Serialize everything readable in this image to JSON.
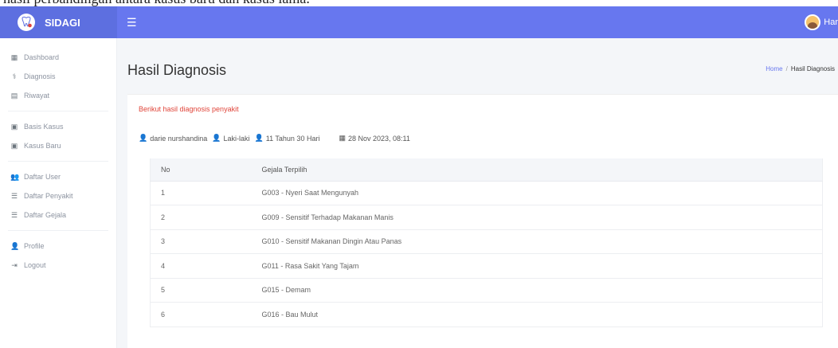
{
  "brand": {
    "name": "SIDAGI"
  },
  "navbar": {
    "user_name": "Har"
  },
  "sidebar": {
    "groups": [
      [
        {
          "icon": "grid-icon",
          "label": "Dashboard"
        },
        {
          "icon": "stethoscope-icon",
          "label": "Diagnosis"
        },
        {
          "icon": "clipboard-icon",
          "label": "Riwayat"
        }
      ],
      [
        {
          "icon": "folder-icon",
          "label": "Basis Kasus"
        },
        {
          "icon": "folder-icon",
          "label": "Kasus Baru"
        }
      ],
      [
        {
          "icon": "users-icon",
          "label": "Daftar User"
        },
        {
          "icon": "list-icon",
          "label": "Daftar Penyakit"
        },
        {
          "icon": "list-icon",
          "label": "Daftar Gejala"
        }
      ],
      [
        {
          "icon": "user-icon",
          "label": "Profile"
        },
        {
          "icon": "logout-icon",
          "label": "Logout"
        }
      ]
    ]
  },
  "page": {
    "title": "Hasil Diagnosis",
    "breadcrumb": {
      "home": "Home",
      "separator": "/",
      "current": "Hasil Diagnosis"
    }
  },
  "card": {
    "title": "Berikut hasil diagnosis penyakit",
    "meta": {
      "name": "darie nurshandina",
      "gender": "Laki-laki",
      "age": "11 Tahun 30 Hari",
      "date": "28 Nov 2023, 08:11"
    },
    "table": {
      "headers": [
        "No",
        "Gejala Terpilih"
      ],
      "rows": [
        [
          "1",
          "G003 - Nyeri Saat Mengunyah"
        ],
        [
          "2",
          "G009 - Sensitif Terhadap Makanan Manis"
        ],
        [
          "3",
          "G010 - Sensitif Makanan Dingin Atau Panas"
        ],
        [
          "4",
          "G011 - Rasa Sakit Yang Tajam"
        ],
        [
          "5",
          "G015 - Demam"
        ],
        [
          "6",
          "G016 - Bau Mulut"
        ]
      ]
    }
  },
  "colors": {
    "navbar": "#6777ef",
    "brand_bg": "#5d6fe0",
    "accent_red": "#e0453a",
    "link": "#6777ef"
  }
}
